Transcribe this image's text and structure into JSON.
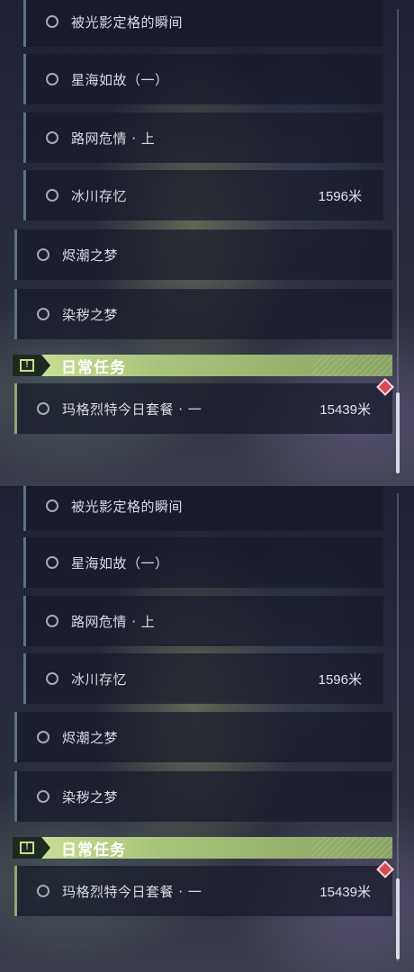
{
  "panels": [
    {
      "sub_quests": [
        {
          "label": "被光影定格的瞬间",
          "distance": ""
        },
        {
          "label": "星海如故（一）",
          "distance": ""
        },
        {
          "label": "路网危情 · 上",
          "distance": ""
        },
        {
          "label": "冰川存忆",
          "distance": "1596米"
        }
      ],
      "main_quests": [
        {
          "label": "烬潮之梦"
        },
        {
          "label": "染秽之梦"
        }
      ],
      "daily_header": {
        "title": "日常任务",
        "icon": "exclamation-box-icon"
      },
      "daily_quests": [
        {
          "label": "玛格烈特今日套餐 · 一",
          "distance": "15439米"
        }
      ]
    },
    {
      "sub_quests": [
        {
          "label": "被光影定格的瞬间",
          "distance": ""
        },
        {
          "label": "星海如故（一）",
          "distance": ""
        },
        {
          "label": "路网危情 · 上",
          "distance": ""
        },
        {
          "label": "冰川存忆",
          "distance": "1596米"
        }
      ],
      "main_quests": [
        {
          "label": "烬潮之梦"
        },
        {
          "label": "染秽之梦"
        }
      ],
      "daily_header": {
        "title": "日常任务",
        "icon": "exclamation-box-icon"
      },
      "daily_quests": [
        {
          "label": "玛格烈特今日套餐 · 一",
          "distance": "15439米"
        }
      ]
    }
  ],
  "colors": {
    "daily_accent": "#a9c27a",
    "track_marker": "#d44b57",
    "quest_bar": "#5c7186"
  }
}
